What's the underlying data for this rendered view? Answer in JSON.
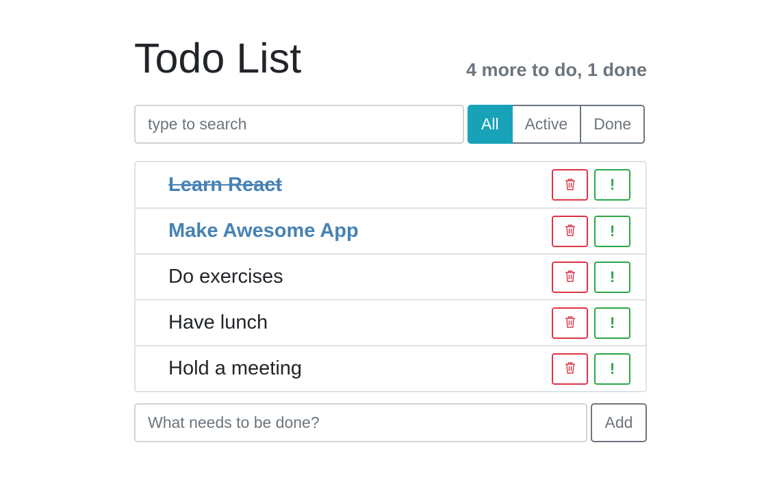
{
  "header": {
    "title": "Todo List",
    "status": "4 more to do, 1 done"
  },
  "search": {
    "placeholder": "type to search",
    "value": ""
  },
  "filters": [
    {
      "label": "All",
      "active": true
    },
    {
      "label": "Active",
      "active": false
    },
    {
      "label": "Done",
      "active": false
    }
  ],
  "todos": [
    {
      "label": "Learn React",
      "done": true,
      "important": true
    },
    {
      "label": "Make Awesome App",
      "done": false,
      "important": true
    },
    {
      "label": "Do exercises",
      "done": false,
      "important": false
    },
    {
      "label": "Have lunch",
      "done": false,
      "important": false
    },
    {
      "label": "Hold a meeting",
      "done": false,
      "important": false
    }
  ],
  "item_actions": {
    "delete_icon": "trash-icon",
    "important_icon": "exclamation-icon",
    "important_glyph": "!"
  },
  "add_form": {
    "placeholder": "What needs to be done?",
    "value": "",
    "button_label": "Add"
  },
  "colors": {
    "info": "#17a2b8",
    "danger": "#dc3545",
    "success": "#28a745",
    "secondary": "#6c757d",
    "highlight": "#4682b4"
  }
}
